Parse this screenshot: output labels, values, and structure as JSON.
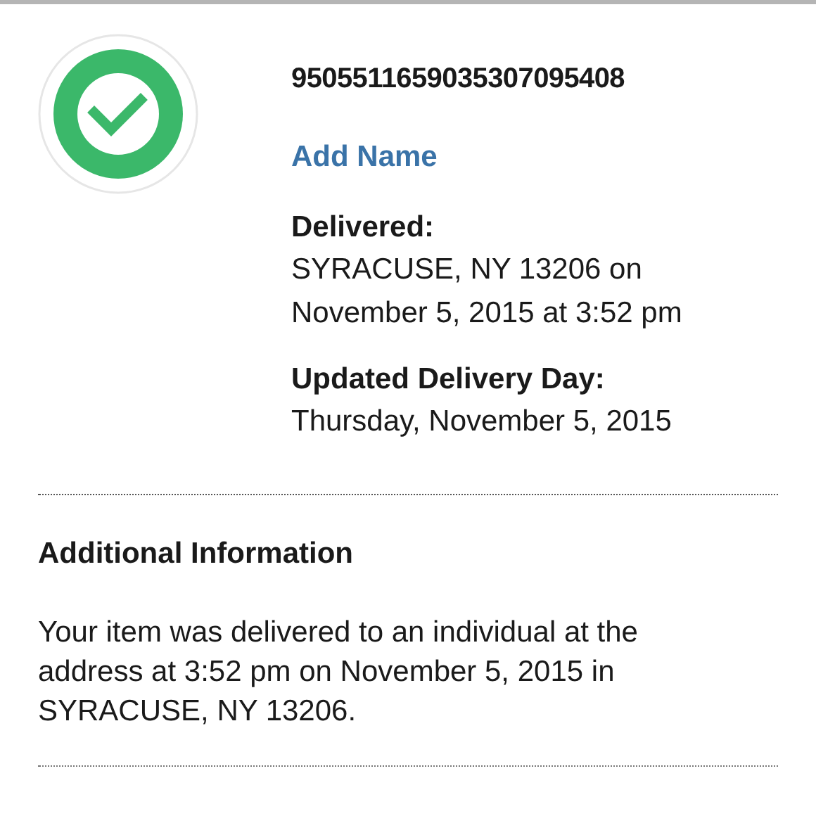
{
  "status_icon": {
    "kind": "delivered"
  },
  "tracking_number": "9505511659035307095408",
  "add_name_link": "Add Name",
  "details": [
    {
      "label": "Delivered:",
      "lines": [
        "SYRACUSE, NY 13206 on",
        "November 5, 2015 at 3:52 pm"
      ]
    },
    {
      "label": "Updated Delivery Day:",
      "lines": [
        "Thursday, November 5, 2015"
      ]
    }
  ],
  "additional_information": {
    "title": "Additional Information",
    "text": "Your item was delivered to an individual at the address at 3:52 pm on November 5, 2015 in SYRACUSE, NY 13206."
  }
}
